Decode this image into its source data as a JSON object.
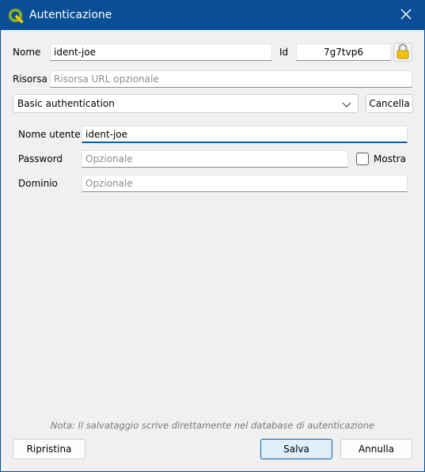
{
  "window": {
    "title": "Autenticazione"
  },
  "form": {
    "name_label": "Nome",
    "name_value": "ident-joe",
    "id_label": "Id",
    "id_value": "7g7tvp6",
    "resource_label": "Risorsa",
    "resource_placeholder": "Risorsa URL opzionale",
    "method_selected": "Basic authentication",
    "clear_label": "Cancella"
  },
  "basic_auth": {
    "username_label": "Nome utente",
    "username_value": "ident-joe",
    "password_label": "Password",
    "password_placeholder": "Opzionale",
    "show_label": "Mostra",
    "show_checked": false,
    "domain_label": "Dominio",
    "domain_placeholder": "Opzionale"
  },
  "footer": {
    "note": "Nota: Il salvataggio scrive direttamente nel database di autenticazione",
    "reset_label": "Ripristina",
    "save_label": "Salva",
    "cancel_label": "Annulla"
  },
  "icons": {
    "app": "qgis-logo-icon",
    "close": "close-icon",
    "lock": "lock-icon",
    "dropdown": "chevron-down-icon"
  },
  "colors": {
    "titlebar": "#0a4f95",
    "accent": "#0a5ea9",
    "lock": "#f2c40c"
  }
}
